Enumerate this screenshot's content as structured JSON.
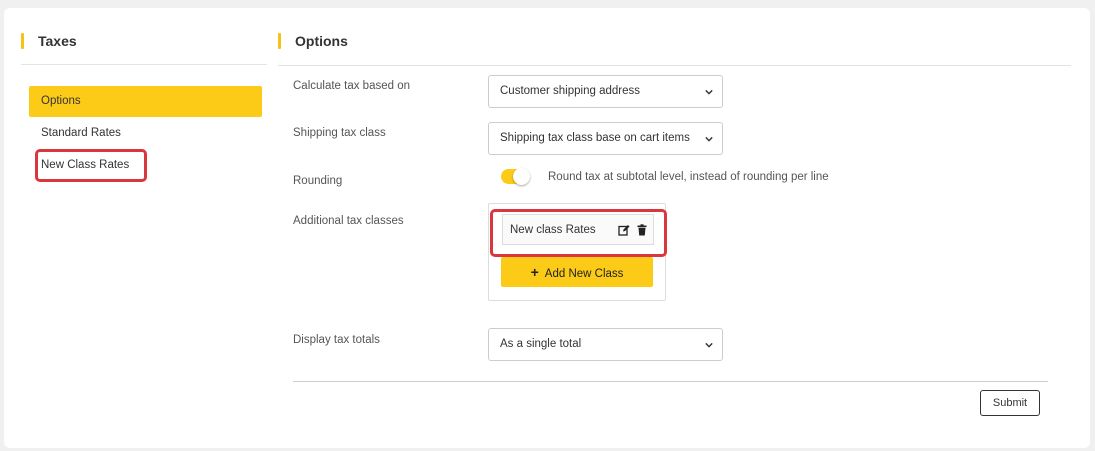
{
  "sidebar": {
    "title": "Taxes",
    "items": [
      {
        "label": "Options"
      },
      {
        "label": "Standard Rates"
      },
      {
        "label": "New Class Rates"
      }
    ]
  },
  "main": {
    "title": "Options",
    "calculate_tax": {
      "label": "Calculate tax based on",
      "value": "Customer shipping address"
    },
    "shipping_tax_class": {
      "label": "Shipping tax class",
      "value": "Shipping tax class base on cart items"
    },
    "rounding": {
      "label": "Rounding",
      "toggle_text": "Round tax at subtotal level, instead of rounding per line",
      "enabled": true
    },
    "additional_classes": {
      "label": "Additional tax classes",
      "items": [
        {
          "name": "New class Rates"
        }
      ],
      "add_button": "Add New Class"
    },
    "display_totals": {
      "label": "Display tax totals",
      "value": "As a single total"
    },
    "submit_label": "Submit"
  },
  "colors": {
    "accent": "#fbcb17",
    "highlight": "#d9363e"
  },
  "icons": {
    "edit": "edit-icon",
    "delete": "trash-icon",
    "add": "plus-icon",
    "select": "chevron-down-icon"
  }
}
